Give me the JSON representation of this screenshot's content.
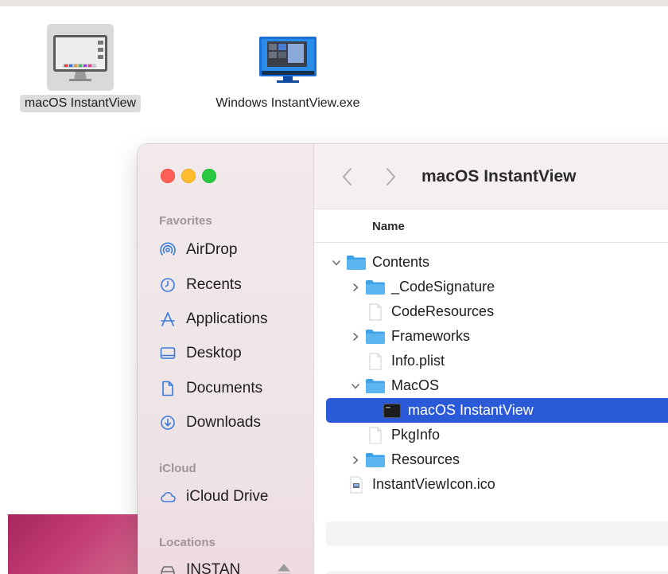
{
  "desktop": {
    "icons": [
      {
        "label": "macOS InstantView",
        "selected": true
      },
      {
        "label": "Windows InstantView.exe",
        "selected": false
      }
    ]
  },
  "finder": {
    "title": "macOS InstantView",
    "sidebar": {
      "favorites_header": "Favorites",
      "favorites": [
        {
          "label": "AirDrop",
          "icon": "airdrop-icon"
        },
        {
          "label": "Recents",
          "icon": "clock-icon"
        },
        {
          "label": "Applications",
          "icon": "applications-icon"
        },
        {
          "label": "Desktop",
          "icon": "desktop-icon"
        },
        {
          "label": "Documents",
          "icon": "document-icon"
        },
        {
          "label": "Downloads",
          "icon": "download-icon"
        }
      ],
      "icloud_header": "iCloud",
      "icloud": [
        {
          "label": "iCloud Drive",
          "icon": "cloud-icon"
        }
      ],
      "locations_header": "Locations",
      "locations": [
        {
          "label": "INSTAN",
          "icon": "drive-icon"
        }
      ]
    },
    "columns": {
      "name": "Name"
    },
    "rows": [
      {
        "label": "Contents",
        "type": "folder",
        "disclosure": "expanded",
        "depth": 0
      },
      {
        "label": "_CodeSignature",
        "type": "folder",
        "disclosure": "collapsed",
        "depth": 1
      },
      {
        "label": "CodeResources",
        "type": "file",
        "disclosure": "none",
        "depth": 1
      },
      {
        "label": "Frameworks",
        "type": "folder",
        "disclosure": "collapsed",
        "depth": 1
      },
      {
        "label": "Info.plist",
        "type": "file",
        "disclosure": "none",
        "depth": 1
      },
      {
        "label": "MacOS",
        "type": "folder",
        "disclosure": "expanded",
        "depth": 1
      },
      {
        "label": "macOS InstantView",
        "type": "executable",
        "disclosure": "none",
        "depth": 2,
        "selected": true
      },
      {
        "label": "PkgInfo",
        "type": "file",
        "disclosure": "none",
        "depth": 1
      },
      {
        "label": "Resources",
        "type": "folder",
        "disclosure": "collapsed",
        "depth": 1
      },
      {
        "label": "InstantViewIcon.ico",
        "type": "ico",
        "disclosure": "none",
        "depth": 0
      }
    ]
  },
  "colors": {
    "selection": "#2a5ad7",
    "folder": "#3fa2e8",
    "close": "#fe5f57",
    "minimize": "#febc2e",
    "maximize": "#28c840"
  }
}
